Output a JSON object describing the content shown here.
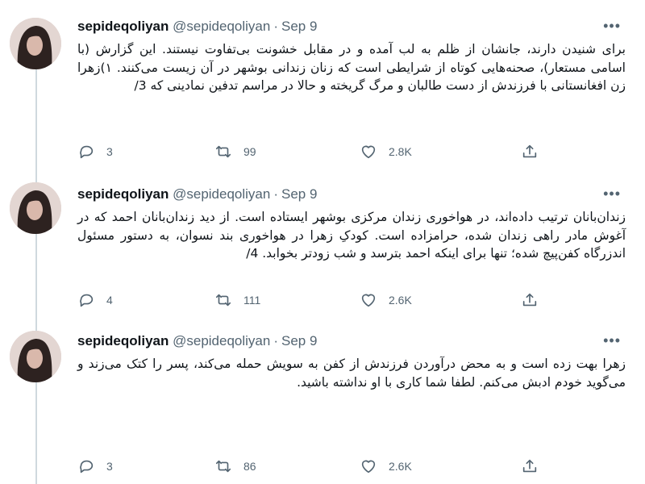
{
  "tweets": [
    {
      "name": "sepideqoliyan",
      "handle": "@sepideqoliyan",
      "separator": "·",
      "date": "Sep 9",
      "more_icon": "more-dots-icon",
      "text": "برای شنیدن دارند، جانشان از ظلم به لب آمده و در مقابل خشونت بی‌تفاوت نیستند. این گزارش (با اسامی مستعار)، صحنه‌هایی کوتاه از شرایطی است که زنان زندانی بوشهر در آن زیست می‌کنند. ۱)زهرا زن افغانستانی با فرزندش از دست طالبان و مرگ گریخته و حالا در مراسم تدفین نمادینی که 3/",
      "replies": "3",
      "retweets": "99",
      "likes": "2.8K"
    },
    {
      "name": "sepideqoliyan",
      "handle": "@sepideqoliyan",
      "separator": "·",
      "date": "Sep 9",
      "more_icon": "more-dots-icon",
      "text": "زندان‌بانان ترتیب داده‌اند، در هواخوری زندان مرکزی بوشهر ایستاده است. از دید زندان‌بانان احمد که در آغوش مادر راهی زندان شده، حرامزاده است. کودکِ زهرا در هواخوری بند نسوان، به دستور مسئول اندزرگاه کفن‌پیچ شده؛ تنها برای اینکه احمد بترسد و شب زودتر بخوابد. 4/",
      "replies": "4",
      "retweets": "111",
      "likes": "2.6K"
    },
    {
      "name": "sepideqoliyan",
      "handle": "@sepideqoliyan",
      "separator": "·",
      "date": "Sep 9",
      "more_icon": "more-dots-icon",
      "text": "زهرا بهت زده است و به محض درآوردن فرزندش از کفن به سویش حمله می‌کند، پسر را کتک می‌زند و می‌گوید خودم ادبش می‌کنم. لطفا شما کاری با او نداشته باشید.",
      "replies": "3",
      "retweets": "86",
      "likes": "2.6K"
    }
  ],
  "icons": {
    "reply": "reply-icon",
    "retweet": "retweet-icon",
    "like": "like-icon",
    "share": "share-icon"
  }
}
